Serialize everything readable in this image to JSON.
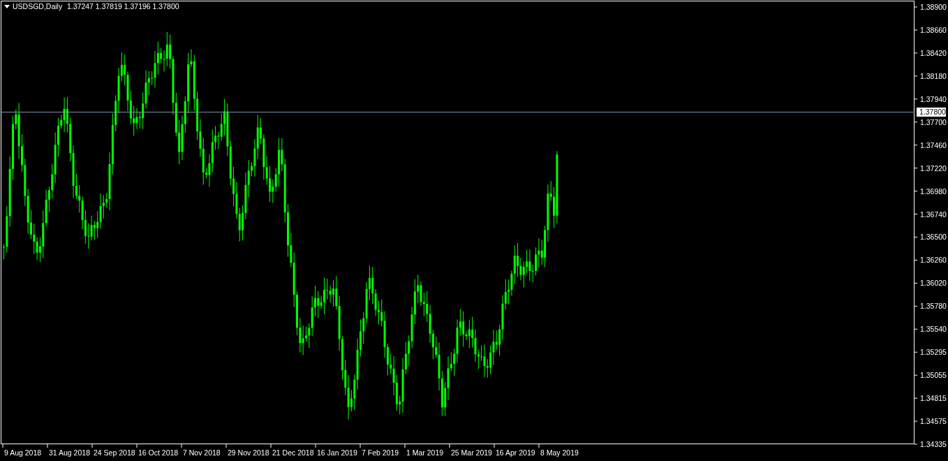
{
  "chart_header": {
    "symbol": "USDSGD,Daily",
    "ohlc": "1.37247 1.37819 1.37196 1.37800"
  },
  "price_axis": [
    "1.38900",
    "1.38660",
    "1.38420",
    "1.38180",
    "1.37940",
    "1.37700",
    "1.37460",
    "1.37220",
    "1.36980",
    "1.36740",
    "1.36500",
    "1.36260",
    "1.36020",
    "1.35780",
    "1.35540",
    "1.35295",
    "1.35055",
    "1.34815",
    "1.34575",
    "1.34335"
  ],
  "current_price": "1.37800",
  "date_axis": [
    "9 Aug 2018",
    "31 Aug 2018",
    "24 Sep 2018",
    "16 Oct 2018",
    "7 Nov 2018",
    "29 Nov 2018",
    "21 Dec 2018",
    "16 Jan 2019",
    "7 Feb 2019",
    "1 Mar 2019",
    "25 Mar 2019",
    "16 Apr 2019",
    "8 May 2019"
  ]
}
